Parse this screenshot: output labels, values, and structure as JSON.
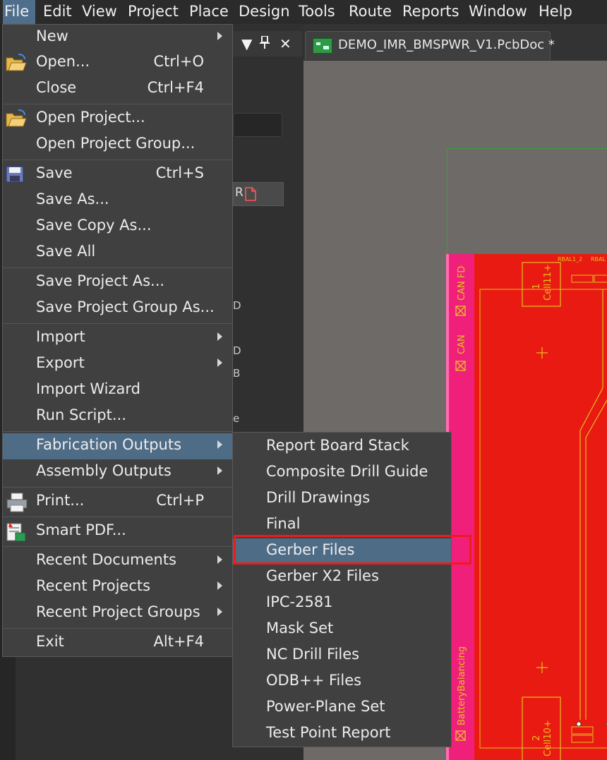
{
  "menubar": {
    "items": [
      "File",
      "Edit",
      "View",
      "Project",
      "Place",
      "Design",
      "Tools",
      "Route",
      "Reports",
      "Window",
      "Help"
    ]
  },
  "panel": {
    "rows": [
      "",
      "",
      "D",
      "",
      "D",
      "B",
      "",
      "e"
    ]
  },
  "document_tab": {
    "title": "DEMO_IMR_BMSPWR_V1.PcbDoc *"
  },
  "pcb": {
    "labels": [
      "CAN FD",
      "CAN",
      "BatteryBalancing",
      "1",
      "Cell11+",
      "2",
      "Cell10+",
      "RBAL1_2",
      "RBAL"
    ],
    "colors": {
      "copper": "#e81a12",
      "keepout": "#f0207a",
      "track": "#e6c020",
      "outline": "#3aa03a"
    }
  },
  "file_menu": {
    "items": [
      {
        "label": "New",
        "shortcut": "",
        "submenu": true
      },
      {
        "label": "Open...",
        "shortcut": "Ctrl+O",
        "submenu": false,
        "icon": "open-folder-icon"
      },
      {
        "label": "Close",
        "shortcut": "Ctrl+F4",
        "submenu": false
      },
      {
        "label": "Open Project...",
        "shortcut": "",
        "submenu": false,
        "icon": "open-folder-icon"
      },
      {
        "label": "Open Project Group...",
        "shortcut": "",
        "submenu": false
      },
      {
        "label": "Save",
        "shortcut": "Ctrl+S",
        "submenu": false,
        "icon": "floppy-disk-icon"
      },
      {
        "label": "Save As...",
        "shortcut": "",
        "submenu": false
      },
      {
        "label": "Save Copy As...",
        "shortcut": "",
        "submenu": false
      },
      {
        "label": "Save All",
        "shortcut": "",
        "submenu": false
      },
      {
        "label": "Save Project As...",
        "shortcut": "",
        "submenu": false
      },
      {
        "label": "Save Project Group As...",
        "shortcut": "",
        "submenu": false
      },
      {
        "label": "Import",
        "shortcut": "",
        "submenu": true
      },
      {
        "label": "Export",
        "shortcut": "",
        "submenu": true
      },
      {
        "label": "Import Wizard",
        "shortcut": "",
        "submenu": false
      },
      {
        "label": "Run Script...",
        "shortcut": "",
        "submenu": false
      },
      {
        "label": "Fabrication Outputs",
        "shortcut": "",
        "submenu": true,
        "selected": true
      },
      {
        "label": "Assembly Outputs",
        "shortcut": "",
        "submenu": true
      },
      {
        "label": "Print...",
        "shortcut": "Ctrl+P",
        "submenu": false,
        "icon": "printer-icon"
      },
      {
        "label": "Smart PDF...",
        "shortcut": "",
        "submenu": false,
        "icon": "smart-pdf-icon"
      },
      {
        "label": "Recent Documents",
        "shortcut": "",
        "submenu": true
      },
      {
        "label": "Recent Projects",
        "shortcut": "",
        "submenu": true
      },
      {
        "label": "Recent Project Groups",
        "shortcut": "",
        "submenu": true
      },
      {
        "label": "Exit",
        "shortcut": "Alt+F4",
        "submenu": false
      }
    ]
  },
  "fabrication_submenu": {
    "items": [
      {
        "label": "Report Board Stack"
      },
      {
        "label": "Composite Drill Guide"
      },
      {
        "label": "Drill Drawings"
      },
      {
        "label": "Final"
      },
      {
        "label": "Gerber Files",
        "selected": true
      },
      {
        "label": "Gerber X2 Files"
      },
      {
        "label": "IPC-2581"
      },
      {
        "label": "Mask Set"
      },
      {
        "label": "NC Drill Files"
      },
      {
        "label": "ODB++ Files"
      },
      {
        "label": "Power-Plane Set"
      },
      {
        "label": "Test Point Report"
      }
    ]
  },
  "colors": {
    "menu_bg": "#404040",
    "selection": "#4f6c87",
    "highlight_box": "#ee1b1b",
    "menubar_bg": "#2b2b2b"
  }
}
